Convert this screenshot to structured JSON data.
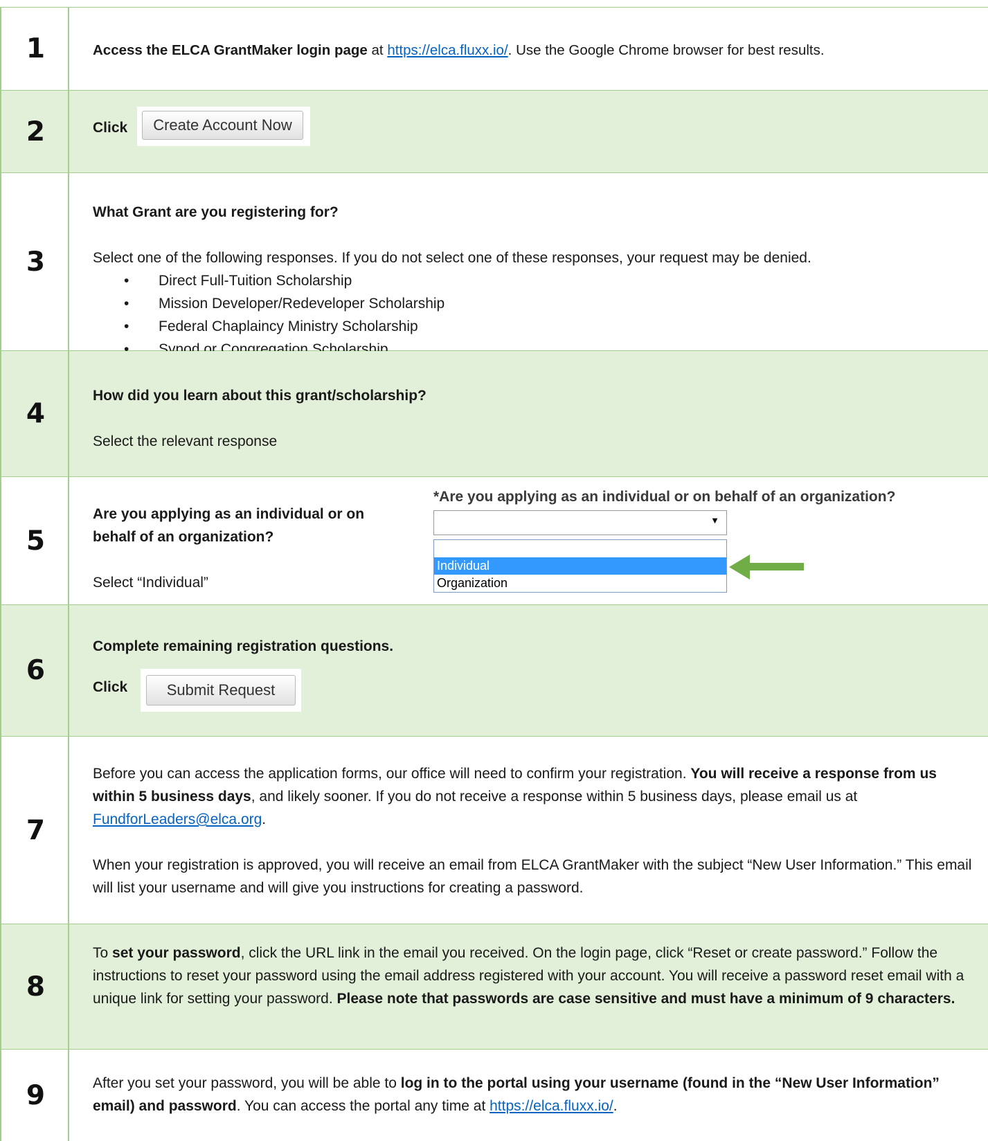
{
  "steps": [
    {
      "num": "1",
      "bold": "Access the ELCA GrantMaker login page",
      "at": " at ",
      "link": "https://elca.fluxx.io/",
      "rest": ". Use the Google Chrome browser for best results."
    },
    {
      "num": "2",
      "click_label": "Click",
      "button": "Create Account Now"
    },
    {
      "num": "3",
      "question": "What Grant are you registering for?",
      "instruction": "Select one of the following responses. If you do not select one of these responses, your request may be denied.",
      "options": [
        "Direct Full-Tuition Scholarship",
        "Mission Developer/Redeveloper Scholarship",
        "Federal Chaplaincy Ministry Scholarship",
        "Synod or Congregation Scholarship"
      ]
    },
    {
      "num": "4",
      "question": "How did you learn about this grant/scholarship?",
      "instruction": "Select the relevant response"
    },
    {
      "num": "5",
      "question_line1": "Are you applying as an individual or on",
      "question_line2": "behalf of an organization?",
      "instruction": "Select “Individual”",
      "form_label": "*Are you applying as an individual or on behalf of an organization?",
      "dropdown_options": [
        "",
        "Individual",
        "Organization"
      ],
      "selected_option": "Individual",
      "arrow_color": "#70ad47"
    },
    {
      "num": "6",
      "heading": "Complete remaining registration questions.",
      "click_label": "Click",
      "button": "Submit Request"
    },
    {
      "num": "7",
      "p1_a": "Before you can access the application forms, our office will need to confirm your registration. ",
      "p1_bold": "You will receive a response from us within 5 business days",
      "p1_b": ", and likely sooner. If you do not receive a response within 5 business days, please email us at ",
      "email": "FundforLeaders@elca.org",
      "p1_c": ".",
      "p2": "When your registration is approved, you will receive an email from ELCA GrantMaker with the subject “New User Information.” This email will list your username and will give you instructions for creating a password."
    },
    {
      "num": "8",
      "a": "To ",
      "bold1": "set your password",
      "b": ", click the URL link in the email you received. On the login page, click “Reset or create password.” Follow the instructions to reset your password using the email address registered with your account. You will receive a password reset email with a unique link for setting your password.  ",
      "bold2": "Please note that passwords are case sensitive and must have a minimum of 9 characters."
    },
    {
      "num": "9",
      "a": "After you set your password, you will be able to ",
      "bold": "log in to the portal using your username (found in the “New User Information” email) and password",
      "b": ". You can access the portal any time at ",
      "link": "https://elca.fluxx.io/",
      "c": "."
    }
  ],
  "colors": {
    "shade": "#e2efd9",
    "border": "#a3cf8c",
    "link": "#0563c1",
    "selection": "#3399ff"
  }
}
